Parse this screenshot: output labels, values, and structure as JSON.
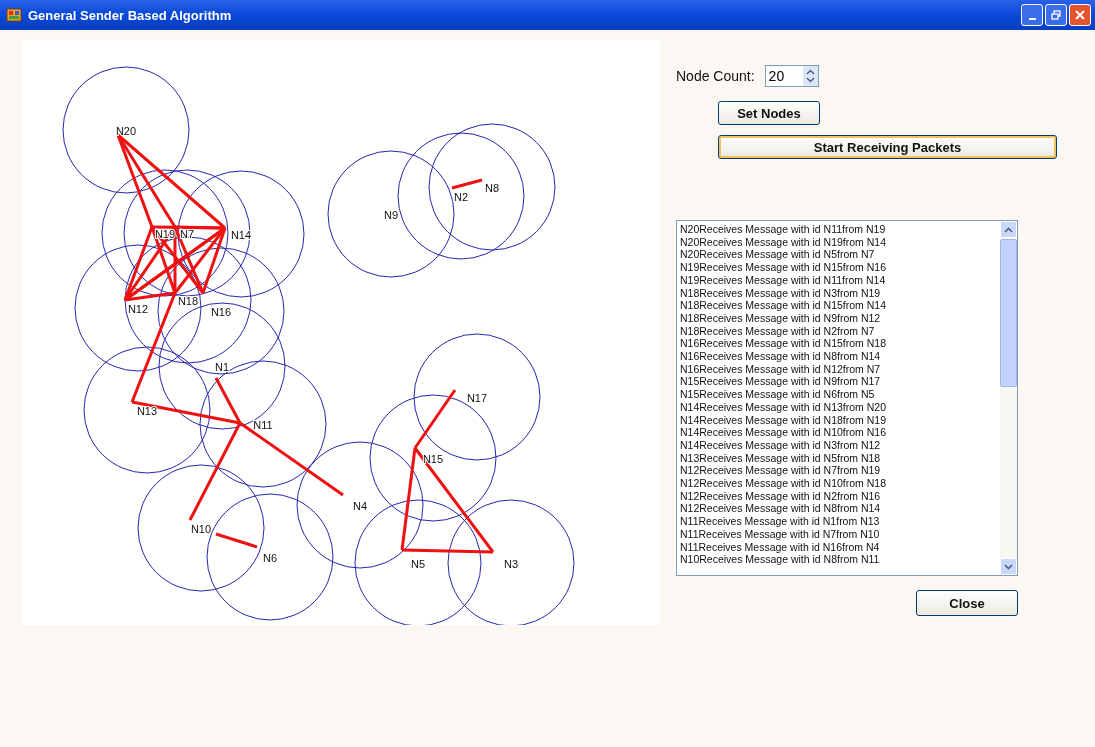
{
  "window": {
    "title": "General Sender Based Algorithm"
  },
  "network": {
    "nodes": [
      {
        "label": "N20"
      },
      {
        "label": "N19"
      },
      {
        "label": "N7"
      },
      {
        "label": "N14"
      },
      {
        "label": "N12"
      },
      {
        "label": "N18"
      },
      {
        "label": "N16"
      },
      {
        "label": "N1"
      },
      {
        "label": "N13"
      },
      {
        "label": "N11"
      },
      {
        "label": "N10"
      },
      {
        "label": "N6"
      },
      {
        "label": "N4"
      },
      {
        "label": "N17"
      },
      {
        "label": "N15"
      },
      {
        "label": "N5"
      },
      {
        "label": "N3"
      },
      {
        "label": "N2"
      },
      {
        "label": "N8"
      },
      {
        "label": "N9"
      }
    ]
  },
  "node_count": {
    "label": "Node Count:",
    "value": "20"
  },
  "buttons": [
    {
      "kind": "small",
      "label": "Set Nodes",
      "focused": false
    },
    {
      "kind": "wide",
      "label": "Start Receiving Packets",
      "focused": true
    }
  ],
  "log": [
    "N20Receives Message with id N11from N19",
    "N20Receives Message with id N19from N14",
    "N20Receives Message with id N5from N7",
    "N19Receives Message with id N15from N16",
    "N19Receives Message with id N11from N14",
    "N18Receives Message with id N3from N19",
    "N18Receives Message with id N15from N14",
    "N18Receives Message with id N9from N12",
    "N18Receives Message with id N2from N7",
    "N16Receives Message with id N15from N18",
    "N16Receives Message with id N8from N14",
    "N16Receives Message with id N12from N7",
    "N15Receives Message with id N9from N17",
    "N15Receives Message with id N6from N5",
    "N14Receives Message with id N13from N20",
    "N14Receives Message with id N18from N19",
    "N14Receives Message with id N10from N16",
    "N14Receives Message with id N3from N12",
    "N13Receives Message with id N5from N18",
    "N12Receives Message with id N7from N19",
    "N12Receives Message with id N10from N18",
    "N12Receives Message with id N2from N16",
    "N12Receives Message with id N8from N14",
    "N11Receives Message with id N1from N13",
    "N11Receives Message with id N7from N10",
    "N11Receives Message with id N16from N4",
    "N10Receives Message with id N8from N11"
  ],
  "close_button": {
    "label": "Close"
  }
}
